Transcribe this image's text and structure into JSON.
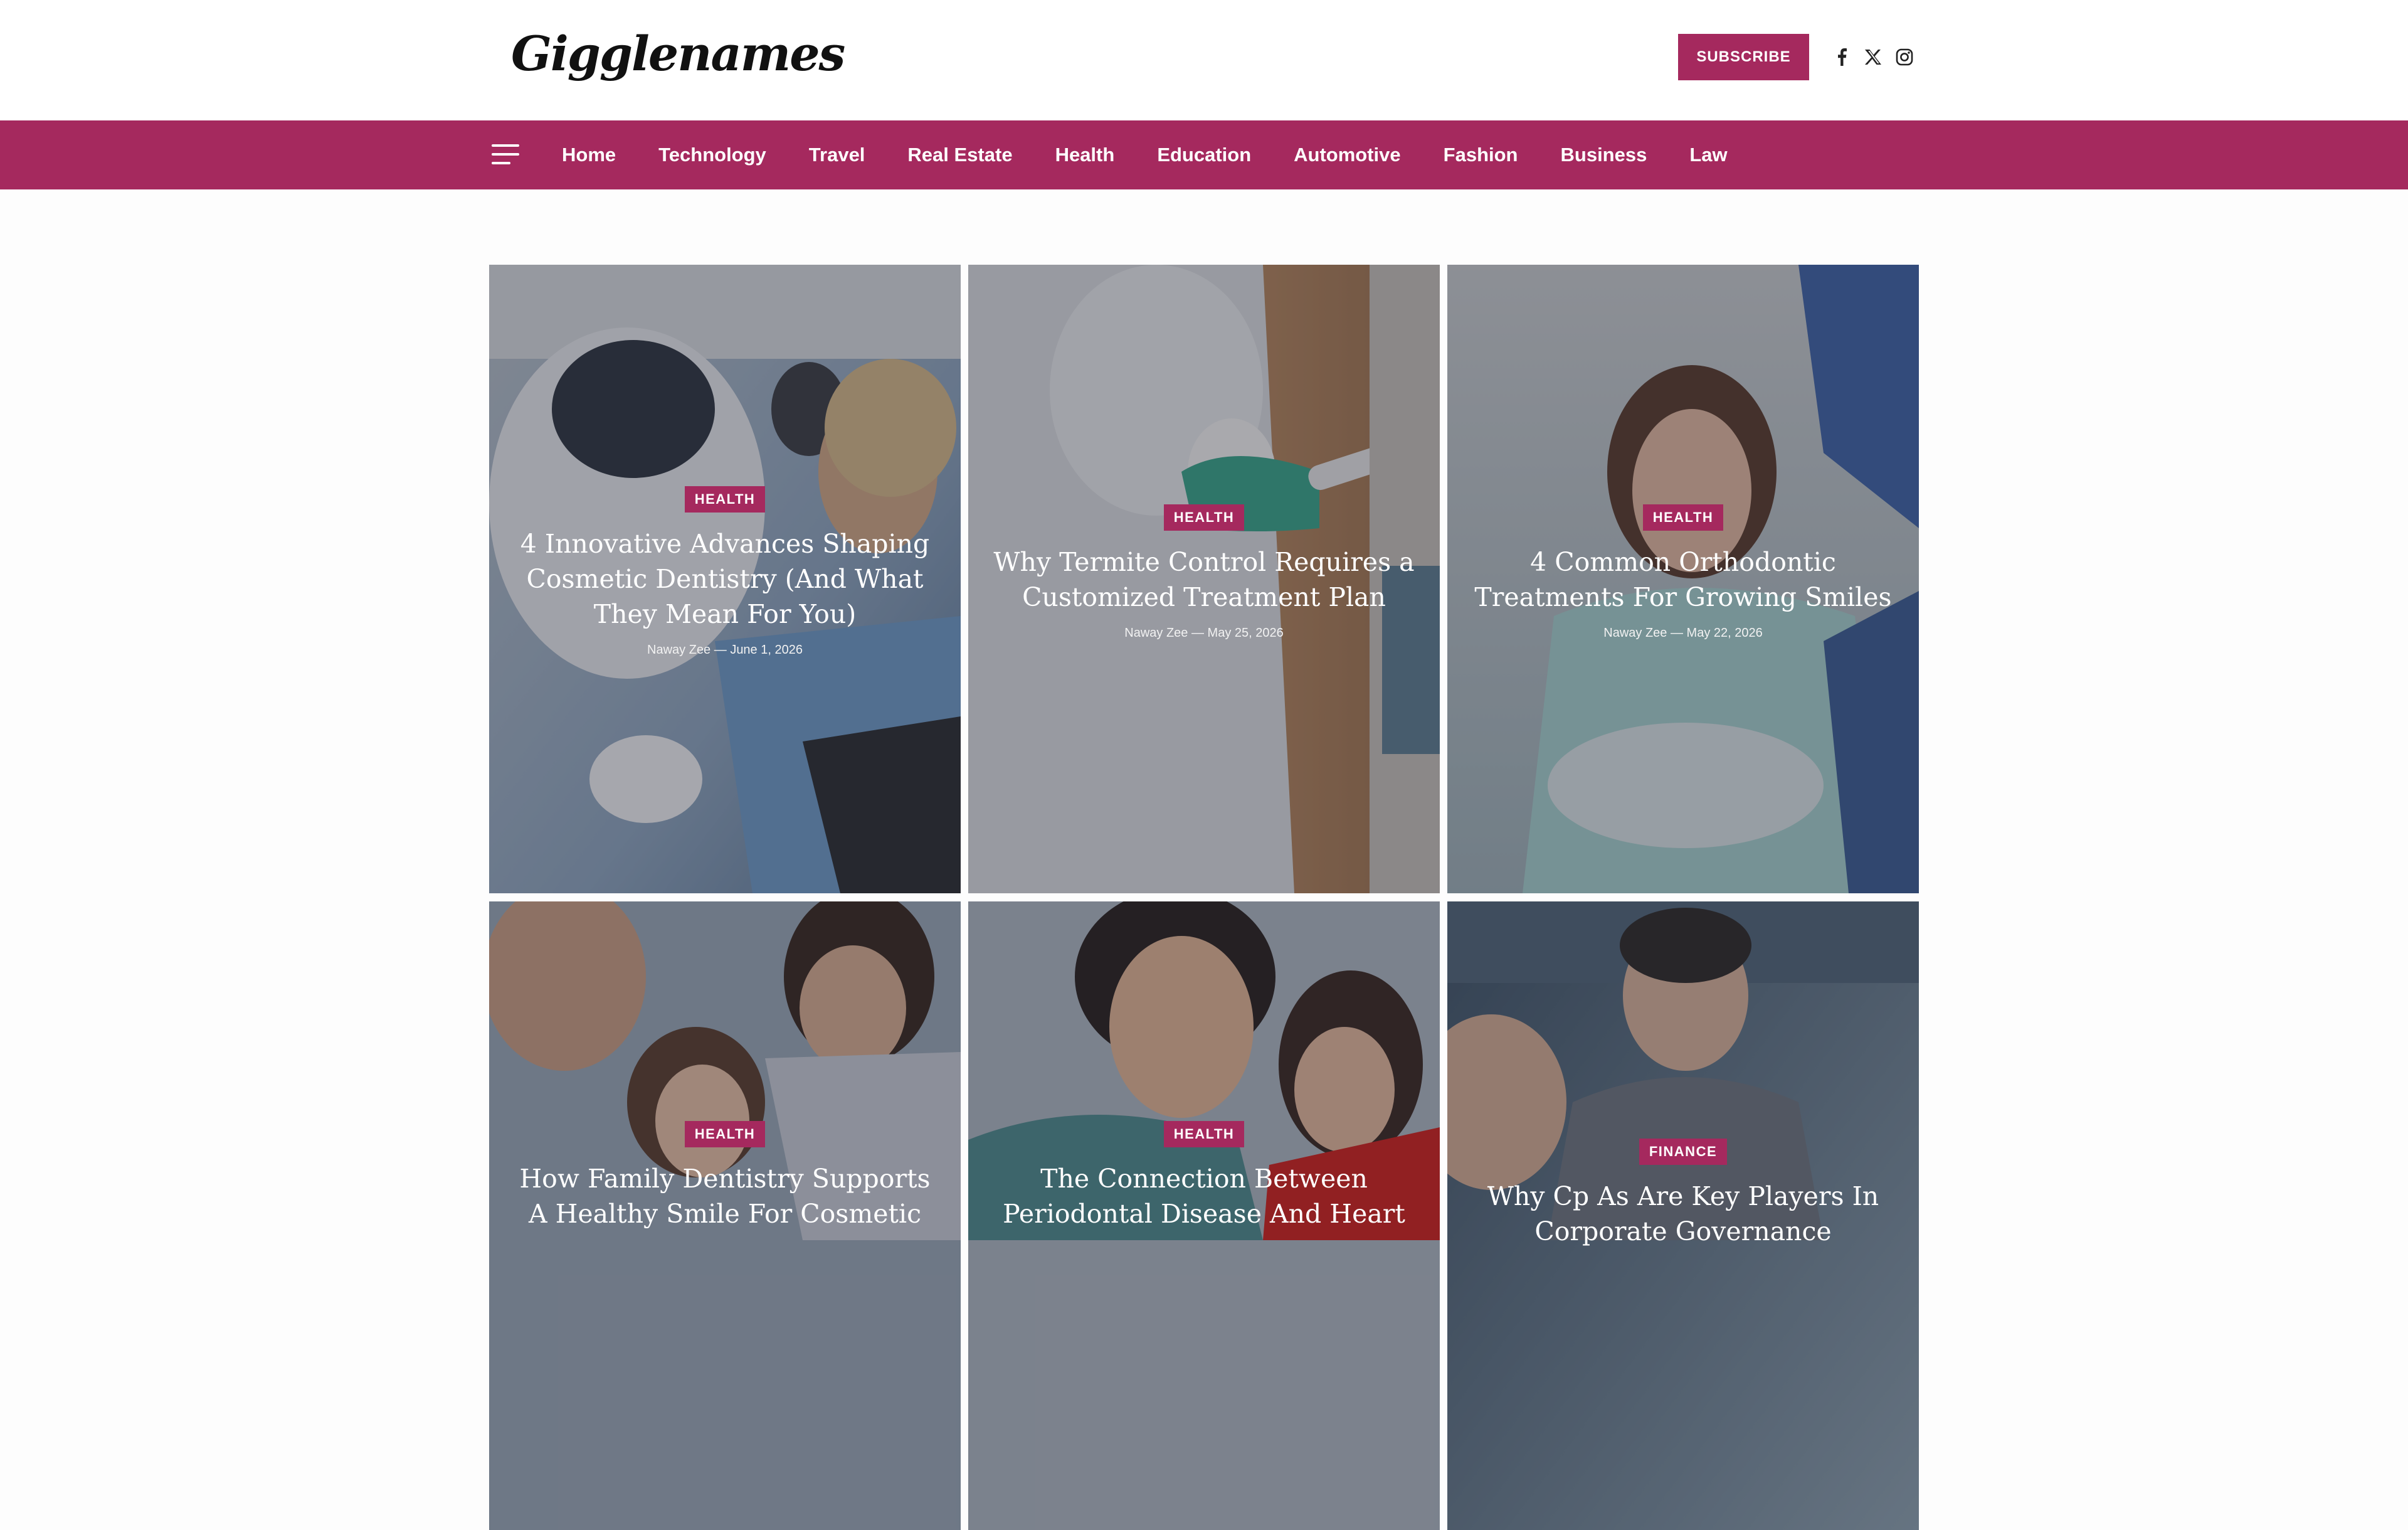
{
  "header": {
    "logo": "Gigglenames",
    "subscribe_label": "SUBSCRIBE",
    "social": [
      "facebook-icon",
      "x-icon",
      "instagram-icon"
    ]
  },
  "nav": {
    "items": [
      "Home",
      "Technology",
      "Travel",
      "Real Estate",
      "Health",
      "Education",
      "Automotive",
      "Fashion",
      "Business",
      "Law"
    ]
  },
  "colors": {
    "accent": "#a5295e",
    "background": "#fdfdfd"
  },
  "posts": [
    {
      "category": "HEALTH",
      "title": "4 Innovative Advances Shaping Cosmetic Dentistry (And What They Mean For You)",
      "author": "Naway Zee",
      "date": "June 1, 2026"
    },
    {
      "category": "HEALTH",
      "title": "Why Termite Control Requires a Customized Treatment Plan",
      "author": "Naway Zee",
      "date": "May 25, 2026"
    },
    {
      "category": "HEALTH",
      "title": "4 Common Orthodontic Treatments For Growing Smiles",
      "author": "Naway Zee",
      "date": "May 22, 2026"
    },
    {
      "category": "HEALTH",
      "title": "How Family Dentistry Supports A Healthy Smile For Cosmetic",
      "author": "",
      "date": ""
    },
    {
      "category": "HEALTH",
      "title": "The Connection Between Periodontal Disease And Heart",
      "author": "",
      "date": ""
    },
    {
      "category": "FINANCE",
      "title": "Why Cp As Are Key Players In Corporate Governance",
      "author": "",
      "date": ""
    }
  ]
}
